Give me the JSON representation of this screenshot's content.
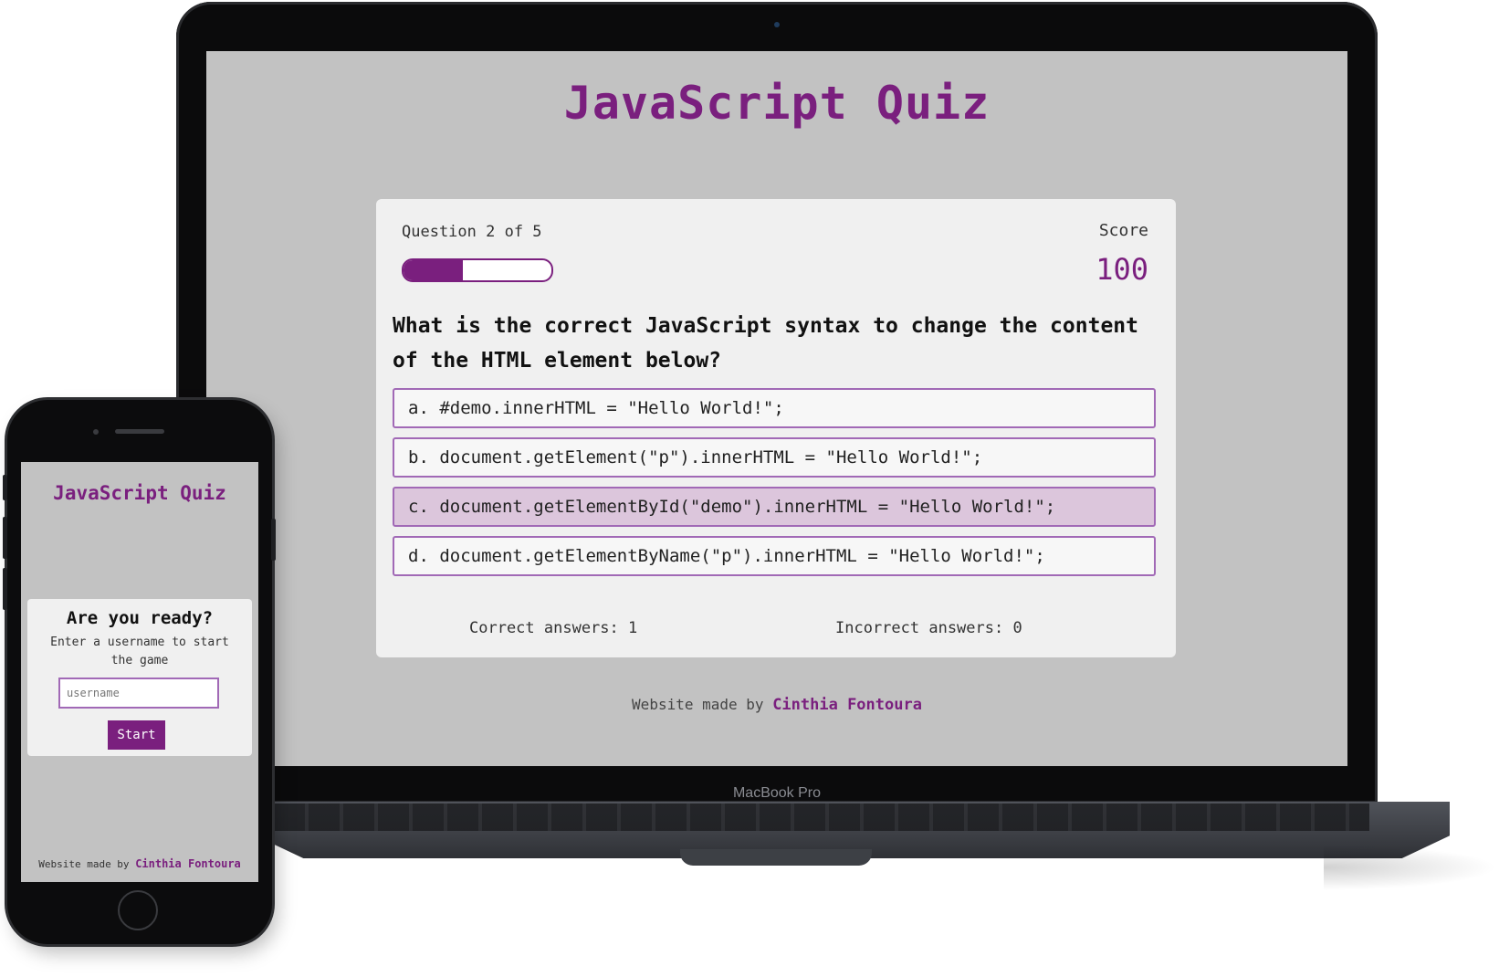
{
  "desktop": {
    "app_title": "JavaScript Quiz",
    "question_progress": "Question 2 of 5",
    "progress_fraction": 0.4,
    "score_label": "Score",
    "score_value": "100",
    "question": "What is the correct JavaScript syntax to change the content of the HTML element below?",
    "choices": [
      {
        "label": "a. #demo.innerHTML = \"Hello World!\";",
        "state": "default"
      },
      {
        "label": "b. document.getElement(\"p\").innerHTML = \"Hello World!\";",
        "state": "default"
      },
      {
        "label": "c. document.getElementById(\"demo\").innerHTML = \"Hello World!\";",
        "state": "hover"
      },
      {
        "label": "d. document.getElementByName(\"p\").innerHTML = \"Hello World!\";",
        "state": "default"
      }
    ],
    "correct_answers": "Correct answers: 1",
    "incorrect_answers": "Incorrect answers: 0",
    "footer_prefix": "Website made by",
    "footer_author": "Cinthia Fontoura"
  },
  "device_label": "MacBook Pro",
  "mobile": {
    "app_title": "JavaScript Quiz",
    "ready_heading": "Are you ready?",
    "ready_hint": "Enter a username to start the game",
    "username_placeholder": "username",
    "start_label": "Start",
    "footer_prefix": "Website made by",
    "footer_author": "Cinthia Fontoura"
  },
  "colors": {
    "accent": "#7a1f7e",
    "choice_border": "#a169b6",
    "choice_hover": "#dcc6dc",
    "screen_bg": "#c2c2c2",
    "card_bg": "#f0f0f0"
  }
}
